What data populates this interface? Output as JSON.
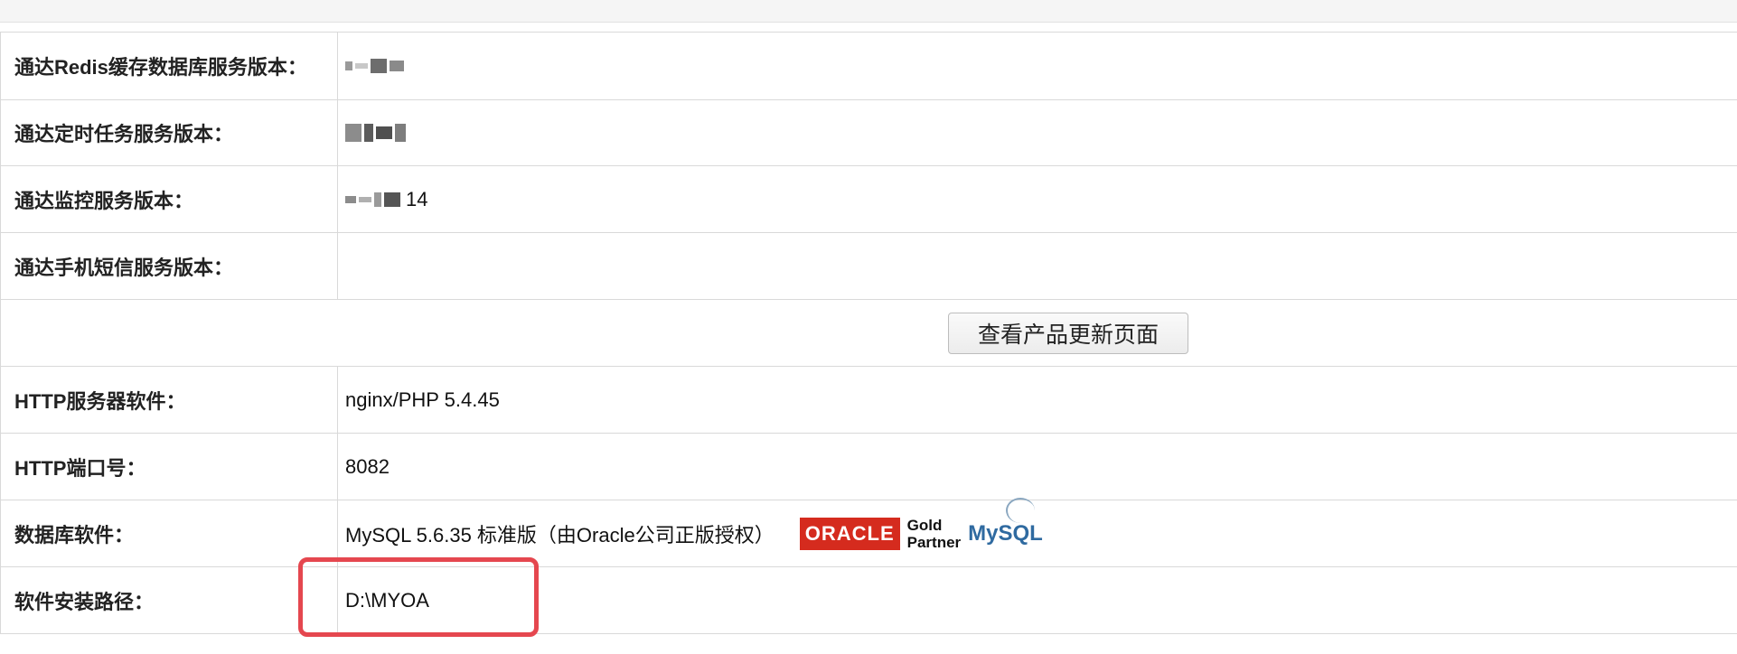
{
  "rows": [
    {
      "label": "通达Redis缓存数据库服务版本：",
      "value": "",
      "blurred": true
    },
    {
      "label": "通达定时任务服务版本：",
      "value": "",
      "blurred": true
    },
    {
      "label": "通达监控服务版本：",
      "value": "14",
      "blurred": true
    },
    {
      "label": "通达手机短信服务版本：",
      "value": ""
    },
    {
      "button": "查看产品更新页面"
    },
    {
      "label": "HTTP服务器软件：",
      "value": "nginx/PHP 5.4.45"
    },
    {
      "label": "HTTP端口号：",
      "value": "8082"
    },
    {
      "label": "数据库软件：",
      "value": "MySQL 5.6.35 标准版（由Oracle公司正版授权）"
    },
    {
      "label": "软件安装路径：",
      "value": "D:\\MYOA"
    }
  ],
  "logos": {
    "oracle": "ORACLE",
    "gold_line1": "Gold",
    "gold_line2": "Partner",
    "mysql": "MySQL"
  },
  "colors": {
    "border": "#d9d9d9",
    "highlight": "#e5474f",
    "oracle_red": "#d52b1e",
    "mysql_blue": "#2f6aa0"
  }
}
